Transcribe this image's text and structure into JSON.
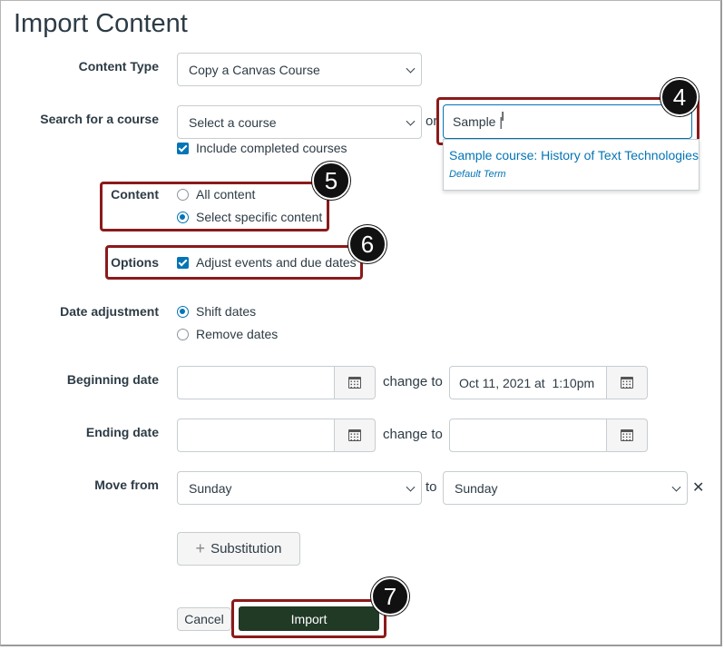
{
  "page": {
    "title": "Import Content"
  },
  "content_type": {
    "label": "Content Type",
    "value": "Copy a Canvas Course"
  },
  "search": {
    "label": "Search for a course",
    "select_placeholder": "Select a course",
    "or_text": "or",
    "input_value": "Sample |",
    "suggestion_title": "Sample course: History of Text Technologies",
    "suggestion_term": "Default Term",
    "include_completed_label": "Include completed courses"
  },
  "content": {
    "label": "Content",
    "option_all": "All content",
    "option_specific": "Select specific content",
    "selected": "Select specific content"
  },
  "options": {
    "label": "Options",
    "adjust_label": "Adjust events and due dates"
  },
  "date_adjustment": {
    "label": "Date adjustment",
    "option_shift": "Shift dates",
    "option_remove": "Remove dates",
    "selected": "Shift dates"
  },
  "beginning_date": {
    "label": "Beginning date",
    "from_value": "",
    "change_to": "change to",
    "to_value": "Oct 11, 2021 at  1:10pm"
  },
  "ending_date": {
    "label": "Ending date",
    "from_value": "",
    "change_to": "change to",
    "to_value": ""
  },
  "move_from": {
    "label": "Move from",
    "from_value": "Sunday",
    "to_text": "to",
    "to_value": "Sunday",
    "remove_symbol": "✕"
  },
  "substitution": {
    "plus": "+",
    "label": "Substitution"
  },
  "actions": {
    "cancel_label": "Cancel",
    "import_label": "Import"
  },
  "callouts": {
    "step4": "4",
    "step5": "5",
    "step6": "6",
    "step7": "7"
  },
  "colors": {
    "accent": "#0374b5",
    "import_button": "#213a26",
    "callout_border": "#8b1a1a",
    "text": "#2d3b45"
  },
  "icons": {
    "calendar": "calendar-icon",
    "chevron": "chevron-down-icon",
    "close": "close-icon",
    "plus": "plus-icon",
    "cursor": "text-cursor-icon"
  }
}
